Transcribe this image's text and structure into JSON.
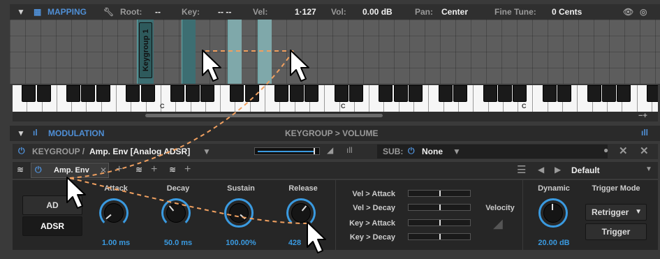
{
  "mapping": {
    "title": "MAPPING",
    "root_label": "Root:",
    "root_value": "--",
    "key_label": "Key:",
    "key_value": "-- --",
    "vel_label": "Vel:",
    "vel_value": "1·127",
    "vol_label": "Vol:",
    "vol_value": "0.00 dB",
    "pan_label": "Pan:",
    "pan_value": "Center",
    "finetune_label": "Fine Tune:",
    "finetune_value": "0 Cents"
  },
  "keygroup_zone": {
    "label": "Keygroup 1"
  },
  "keyboard": {
    "octave_labels": [
      "C",
      "C",
      "C"
    ]
  },
  "modulation": {
    "title": "MODULATION",
    "breadcrumb": "KEYGROUP > VOLUME",
    "keygroup_prefix": "KEYGROUP /",
    "env_name": "Amp. Env [Analog ADSR]",
    "sub_label": "SUB:",
    "sub_value": "None",
    "tab_label": "Amp. Env",
    "preset_value": "Default",
    "mode_ad": "AD",
    "mode_adsr": "ADSR",
    "knobs": [
      {
        "label": "Attack",
        "value": "1.00 ms"
      },
      {
        "label": "Decay",
        "value": "50.0 ms"
      },
      {
        "label": "Sustain",
        "value": "100.00%"
      },
      {
        "label": "Release",
        "value": "428"
      }
    ],
    "sliders": [
      {
        "label": "Vel > Attack"
      },
      {
        "label": "Vel > Decay"
      },
      {
        "label": "Key > Attack"
      },
      {
        "label": "Key > Decay"
      }
    ],
    "velocity_label": "Velocity",
    "dynamic_label": "Dynamic",
    "dynamic_value": "20.00 dB",
    "trigger_mode_label": "Trigger Mode",
    "trigger_mode_value": "Retrigger",
    "trigger_button": "Trigger"
  },
  "colors": {
    "accent": "#3a9ae0",
    "brand": "#4f8fd6",
    "cursor_trail": "#f0a060"
  }
}
